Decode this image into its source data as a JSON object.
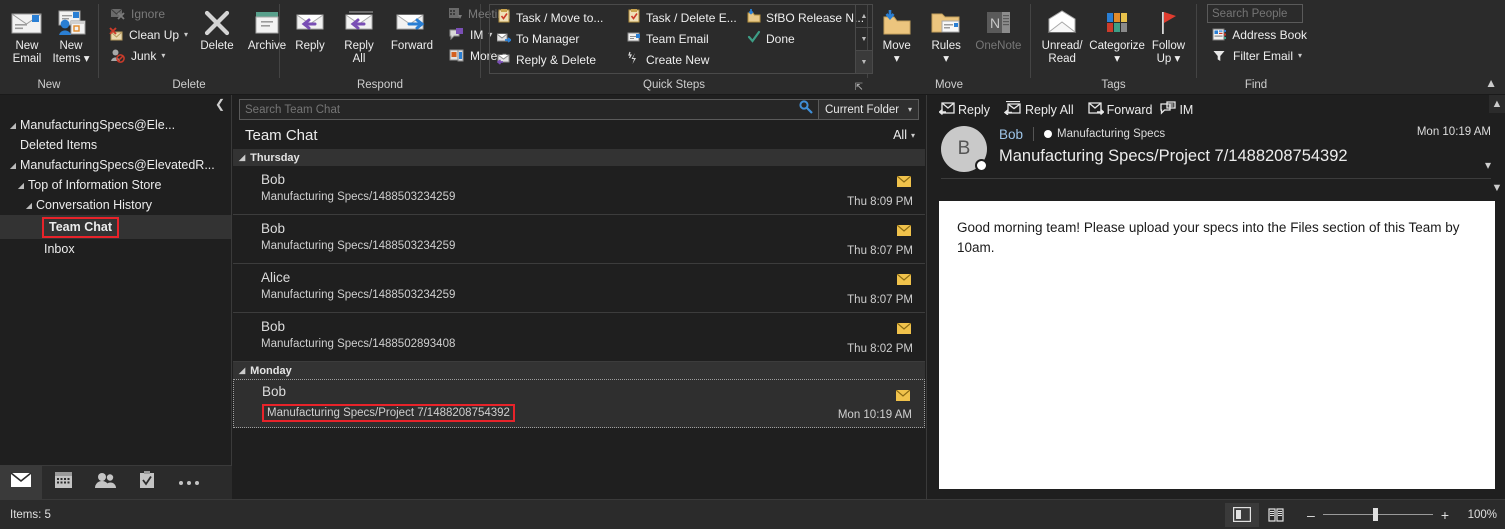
{
  "ribbon": {
    "groups": [
      {
        "name": "New",
        "label": "New",
        "buttons": [
          {
            "label_line1": "New",
            "label_line2": "Email",
            "icon": "new-email-icon"
          },
          {
            "label_line1": "New",
            "label_line2": "Items ▾",
            "icon": "new-items-icon"
          }
        ]
      },
      {
        "name": "Delete",
        "label": "Delete",
        "small": [
          {
            "label": "Ignore",
            "icon": "ignore-icon",
            "disabled": true
          },
          {
            "label": "Clean Up",
            "icon": "clean-up-icon",
            "caret": true,
            "disabled": false
          },
          {
            "label": "Junk",
            "icon": "junk-icon",
            "caret": true,
            "disabled": false
          }
        ],
        "big": [
          {
            "label_line1": "Delete",
            "label_line2": "",
            "icon": "delete-icon"
          },
          {
            "label_line1": "Archive",
            "label_line2": "",
            "icon": "archive-icon"
          }
        ]
      },
      {
        "name": "Respond",
        "label": "Respond",
        "big": [
          {
            "label_line1": "Reply",
            "label_line2": "",
            "icon": "reply-icon"
          },
          {
            "label_line1": "Reply",
            "label_line2": "All",
            "icon": "reply-all-icon"
          },
          {
            "label_line1": "Forward",
            "label_line2": "",
            "icon": "forward-icon"
          }
        ],
        "small": [
          {
            "label": "Meeting",
            "icon": "meeting-icon",
            "disabled": true
          },
          {
            "label": "IM",
            "icon": "im-icon",
            "caret": true,
            "disabled": false
          },
          {
            "label": "More",
            "icon": "more-icon",
            "caret": true,
            "disabled": false
          }
        ]
      },
      {
        "name": "Quick Steps",
        "label": "Quick Steps",
        "items": [
          {
            "label": "Task / Move to...",
            "icon": "task-clipboard-icon"
          },
          {
            "label": "To Manager",
            "icon": "to-manager-icon"
          },
          {
            "label": "Reply & Delete",
            "icon": "reply-delete-icon"
          },
          {
            "label": "Task / Delete E...",
            "icon": "task-clipboard-icon"
          },
          {
            "label": "Team Email",
            "icon": "team-email-icon"
          },
          {
            "label": "Create New",
            "icon": "create-new-icon"
          },
          {
            "label": "SfBO Release N...",
            "icon": "move-folder-icon"
          },
          {
            "label": "Done",
            "icon": "done-check-icon"
          }
        ]
      },
      {
        "name": "Move",
        "label": "Move",
        "big": [
          {
            "label_line1": "Move",
            "label_line2": "▾",
            "icon": "move-icon"
          },
          {
            "label_line1": "Rules",
            "label_line2": "▾",
            "icon": "rules-icon"
          },
          {
            "label_line1": "OneNote",
            "label_line2": "",
            "icon": "onenote-icon",
            "disabled": true
          }
        ]
      },
      {
        "name": "Tags",
        "label": "Tags",
        "big": [
          {
            "label_line1": "Unread/",
            "label_line2": "Read",
            "icon": "unread-read-icon"
          },
          {
            "label_line1": "Categorize",
            "label_line2": "▾",
            "icon": "categorize-icon"
          },
          {
            "label_line1": "Follow",
            "label_line2": "Up ▾",
            "icon": "follow-up-flag-icon"
          }
        ]
      },
      {
        "name": "Find",
        "label": "Find",
        "search_placeholder": "Search People",
        "small": [
          {
            "label": "Address Book",
            "icon": "address-book-icon"
          },
          {
            "label": "Filter Email",
            "icon": "filter-email-icon",
            "caret": true
          }
        ]
      }
    ]
  },
  "nav": {
    "tree": [
      {
        "label": "ManufacturingSpecs@Ele...",
        "indent": 0,
        "twisty": "◢",
        "selected": false
      },
      {
        "label": "Deleted Items",
        "indent": 1,
        "twisty": "",
        "selected": false
      },
      {
        "label": "ManufacturingSpecs@ElevatedR...",
        "indent": 0,
        "twisty": "◢",
        "selected": false
      },
      {
        "label": "Top of Information Store",
        "indent": 1,
        "twisty": "◢",
        "selected": false
      },
      {
        "label": "Conversation History",
        "indent": 2,
        "twisty": "◢",
        "selected": false
      },
      {
        "label": "Team Chat",
        "indent": 3,
        "twisty": "",
        "selected": true,
        "highlighted": true
      },
      {
        "label": "Inbox",
        "indent": 3,
        "twisty": "",
        "selected": false
      }
    ],
    "modules": [
      {
        "name": "mail-module",
        "glyph": "✉",
        "active": true
      },
      {
        "name": "calendar-module",
        "glyph": "▦",
        "active": false
      },
      {
        "name": "people-module",
        "glyph": "👥",
        "active": false
      },
      {
        "name": "tasks-module",
        "glyph": "☑",
        "active": false
      },
      {
        "name": "more-module",
        "glyph": "•••",
        "active": false
      }
    ]
  },
  "list": {
    "search_placeholder": "Search Team Chat",
    "search_value": "",
    "scope_label": "Current Folder",
    "title": "Team Chat",
    "filter_label": "All",
    "groups": [
      {
        "label": "Thursday",
        "rows": [
          {
            "from": "Bob",
            "subject": "Manufacturing Specs/1488503234259",
            "time": "Thu 8:09 PM",
            "unread": true,
            "selected": false
          },
          {
            "from": "Bob",
            "subject": "Manufacturing Specs/1488503234259",
            "time": "Thu 8:07 PM",
            "unread": true,
            "selected": false
          },
          {
            "from": "Alice",
            "subject": "Manufacturing Specs/1488503234259",
            "time": "Thu 8:07 PM",
            "unread": true,
            "selected": false
          },
          {
            "from": "Bob",
            "subject": "Manufacturing Specs/1488502893408",
            "time": "Thu 8:02 PM",
            "unread": true,
            "selected": false
          }
        ]
      },
      {
        "label": "Monday",
        "rows": [
          {
            "from": "Bob",
            "subject": "Manufacturing Specs/Project 7/1488208754392",
            "time": "Mon 10:19 AM",
            "unread": true,
            "selected": true,
            "highlighted": true
          }
        ]
      }
    ]
  },
  "reading": {
    "actions": [
      {
        "label": "Reply",
        "icon": "reply-icon"
      },
      {
        "label": "Reply All",
        "icon": "reply-all-icon"
      },
      {
        "label": "Forward",
        "icon": "forward-icon"
      },
      {
        "label": "IM",
        "icon": "im-icon"
      }
    ],
    "avatar_initial": "B",
    "sender": "Bob",
    "team": "Manufacturing Specs",
    "date": "Mon 10:19 AM",
    "subject": "Manufacturing Specs/Project 7/1488208754392",
    "body": "Good morning team! Please upload your specs into the Files section of this Team by 10am."
  },
  "status": {
    "items_text": "Items: 5",
    "zoom_label": "100%",
    "zoom_minus": "–",
    "zoom_plus": "+"
  },
  "colors": {
    "highlight_red": "#e8232a",
    "chrome_dark": "#1f1f1f",
    "ribbon_bg": "#2b2b2b",
    "unread_envelope": "#f0c24b",
    "sender_blue": "#9ec5e8"
  }
}
